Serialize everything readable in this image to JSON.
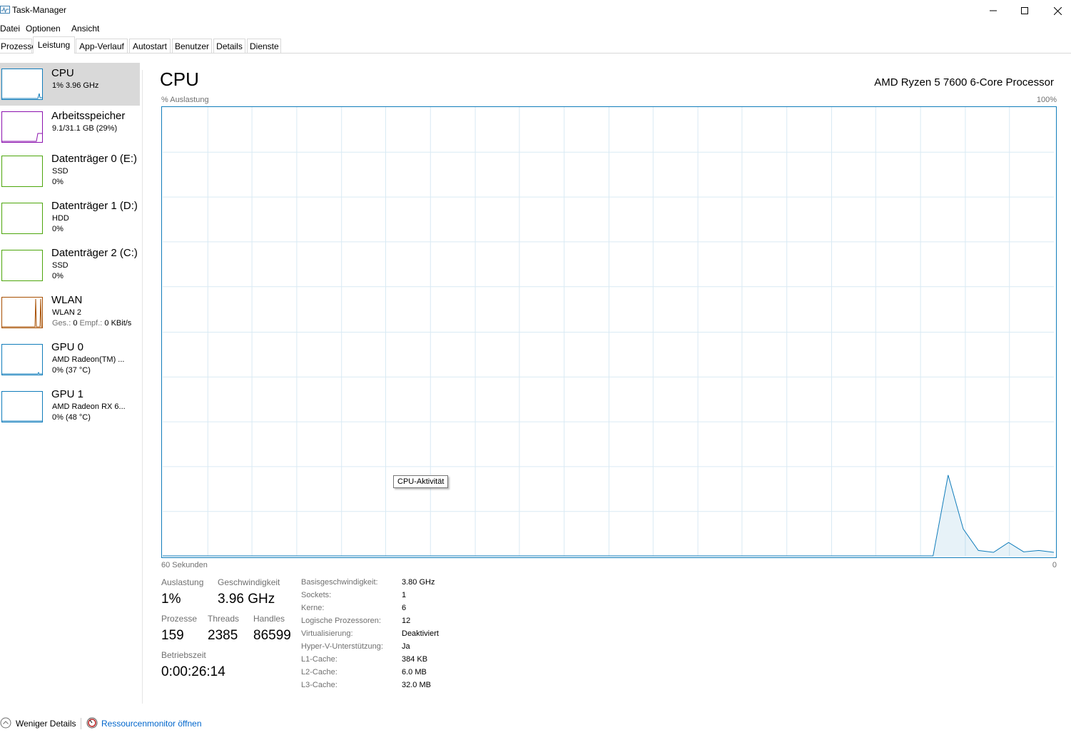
{
  "window": {
    "title": "Task-Manager"
  },
  "menu": [
    "Datei",
    "Optionen",
    "Ansicht"
  ],
  "tabs": [
    "Prozesse",
    "Leistung",
    "App-Verlauf",
    "Autostart",
    "Benutzer",
    "Details",
    "Dienste"
  ],
  "sidebar": {
    "items": [
      {
        "title": "CPU",
        "sub1": "1%  3.96 GHz",
        "sub2": "",
        "color": "#117dbb"
      },
      {
        "title": "Arbeitsspeicher",
        "sub1": "9.1/31.1 GB (29%)",
        "sub2": "",
        "color": "#8b12ae"
      },
      {
        "title": "Datenträger 0 (E:)",
        "sub1": "SSD",
        "sub2": "0%",
        "color": "#4da60c"
      },
      {
        "title": "Datenträger 1 (D:)",
        "sub1": "HDD",
        "sub2": "0%",
        "color": "#4da60c"
      },
      {
        "title": "Datenträger 2 (C:)",
        "sub1": "SSD",
        "sub2": "0%",
        "color": "#4da60c"
      },
      {
        "title": "WLAN",
        "sub1": "WLAN 2",
        "sub2_label1": "Ges.:",
        "sub2_val1": "0",
        "sub2_label2": "Empf.:",
        "sub2_val2": "0 KBit/s",
        "color": "#a74f01"
      },
      {
        "title": "GPU 0",
        "sub1": "AMD Radeon(TM) ...",
        "sub2": "0% (37 °C)",
        "color": "#117dbb"
      },
      {
        "title": "GPU 1",
        "sub1": "AMD Radeon RX 6...",
        "sub2": "0% (48 °C)",
        "color": "#117dbb"
      }
    ]
  },
  "main": {
    "heading": "CPU",
    "cpu_name": "AMD Ryzen 5 7600 6-Core Processor",
    "graph_label": "% Auslastung",
    "graph_max": "100%",
    "graph_time": "60 Sekunden",
    "graph_min": "0",
    "tooltip": "CPU-Aktivität",
    "stats": {
      "util_label": "Auslastung",
      "util_val": "1%",
      "speed_label": "Geschwindigkeit",
      "speed_val": "3.96 GHz",
      "proc_label": "Prozesse",
      "proc_val": "159",
      "threads_label": "Threads",
      "threads_val": "2385",
      "handles_label": "Handles",
      "handles_val": "86599",
      "uptime_label": "Betriebszeit",
      "uptime_val": "0:00:26:14"
    },
    "details": [
      {
        "k": "Basisgeschwindigkeit:",
        "v": "3.80 GHz"
      },
      {
        "k": "Sockets:",
        "v": "1"
      },
      {
        "k": "Kerne:",
        "v": "6"
      },
      {
        "k": "Logische Prozessoren:",
        "v": "12"
      },
      {
        "k": "Virtualisierung:",
        "v": "Deaktiviert"
      },
      {
        "k": "Hyper-V-Unterstützung:",
        "v": "Ja"
      },
      {
        "k": "L1-Cache:",
        "v": "384 KB"
      },
      {
        "k": "L2-Cache:",
        "v": "6.0 MB"
      },
      {
        "k": "L3-Cache:",
        "v": "32.0 MB"
      }
    ],
    "cpu_history_percent": [
      0,
      0,
      0,
      0,
      0,
      0,
      0,
      0,
      0,
      0,
      0,
      0,
      0,
      0,
      0,
      0,
      0,
      0,
      0,
      0,
      0,
      0,
      0,
      0,
      0,
      0,
      0,
      0,
      0,
      0,
      0,
      0,
      0,
      0,
      0,
      0,
      0,
      0,
      0,
      0,
      0,
      0,
      0,
      0,
      0,
      0,
      0,
      0,
      0,
      0,
      0,
      0,
      18,
      6,
      1.2,
      0.8,
      3,
      0.9,
      1.2,
      0.8
    ]
  },
  "footer": {
    "less_details": "Weniger Details",
    "resource_monitor": "Ressourcenmonitor öffnen"
  },
  "colors": {
    "cpu": "#117dbb",
    "grid": "#d9eaf4",
    "selected": "#d9d9d9"
  }
}
